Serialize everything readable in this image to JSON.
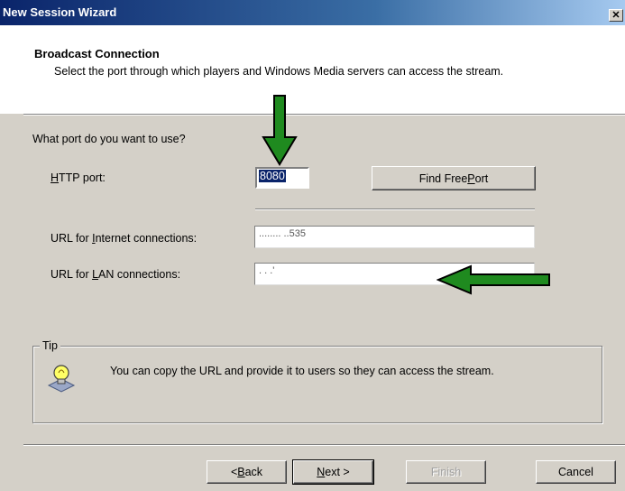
{
  "window": {
    "title": "New Session Wizard",
    "close_glyph": "✕"
  },
  "header": {
    "title": "Broadcast Connection",
    "description": "Select the port through which players and Windows Media servers can access the stream."
  },
  "form": {
    "question": "What port do you want to use?",
    "http_port_label_pre": "",
    "http_port_label_mn": "H",
    "http_port_label_post": "TTP port:",
    "http_port_value": "8080",
    "find_port_pre": "Find Free ",
    "find_port_mn": "P",
    "find_port_post": "ort",
    "internet_label_pre": "URL for ",
    "internet_label_mn": "I",
    "internet_label_post": "nternet connections:",
    "internet_url": "........                    ..535",
    "lan_label_pre": "URL for ",
    "lan_label_mn": "L",
    "lan_label_post": "AN connections:",
    "lan_url": ".                 .   .'"
  },
  "tip": {
    "legend": "Tip",
    "text": "You can copy the URL and provide it to users so they can access the stream.",
    "icon": "lightbulb-icon"
  },
  "footer": {
    "back_pre": "< ",
    "back_mn": "B",
    "back_post": "ack",
    "next_pre": "",
    "next_mn": "N",
    "next_post": "ext >",
    "finish": "Finish",
    "cancel": "Cancel"
  },
  "colors": {
    "titlebar": "#0a246a",
    "arrow": "#1f8a1f",
    "face": "#d4d0c8"
  }
}
